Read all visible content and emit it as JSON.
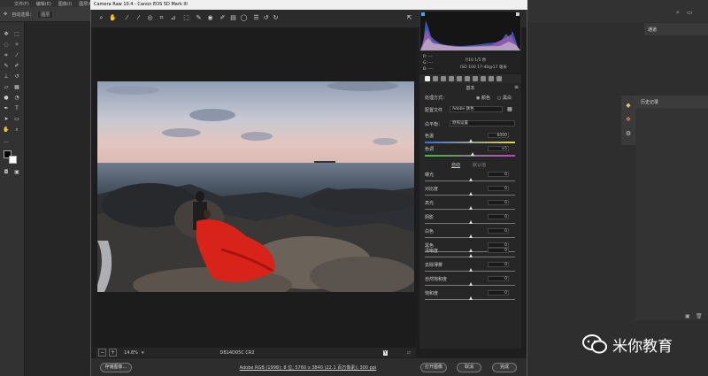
{
  "ps": {
    "menu": [
      "文件(F)",
      "编辑(E)",
      "图像(I)",
      "图层(L)"
    ],
    "options_label": "自动选择：",
    "options_value": "图层",
    "channel_tab": "通道",
    "history_tab": "历史记录"
  },
  "cr": {
    "title": "Camera Raw 10.4  -  Canon EOS 5D Mark III",
    "zoom": "14.8%",
    "filename": "DB14D05C CR2",
    "workflow_link": "Adobe RGB (1998); 8 位; 5760 x 3840 (22.1 百万像素); 300 ppi",
    "buttons": {
      "save": "存储图像…",
      "open": "打开图像",
      "cancel": "取消",
      "done": "完成"
    },
    "meta": {
      "r": "R:  ---",
      "g": "G:  ---",
      "b": "B:  ---",
      "aperture": "f/10   1/5 秒",
      "iso": "ISO 100   17-40@17 毫米"
    },
    "panel": {
      "title": "基本",
      "treatment_label": "处理方式：",
      "color_opt": "颜色",
      "bw_opt": "黑白",
      "profile_label": "配置文件",
      "profile_value": "Adobe 颜色",
      "wb_label": "白平衡：",
      "wb_value": "原照设置",
      "temp_label": "色温",
      "temp_value": "6000",
      "tint_label": "色调",
      "tint_value": "+5",
      "auto": "自动",
      "default": "默认值",
      "sliders": [
        {
          "label": "曝光",
          "value": "0"
        },
        {
          "label": "对比度",
          "value": "0"
        },
        {
          "label": "高光",
          "value": "0"
        },
        {
          "label": "阴影",
          "value": "0"
        },
        {
          "label": "白色",
          "value": "0"
        },
        {
          "label": "黑色",
          "value": "0"
        }
      ],
      "sliders2": [
        {
          "label": "清晰度",
          "value": "0"
        },
        {
          "label": "去除薄雾",
          "value": "0"
        },
        {
          "label": "自然饱和度",
          "value": "0"
        },
        {
          "label": "饱和度",
          "value": "0"
        }
      ]
    }
  },
  "watermark": "米你教育",
  "colors": {
    "accent": "#4a90d9",
    "dress": "#d8231a"
  }
}
